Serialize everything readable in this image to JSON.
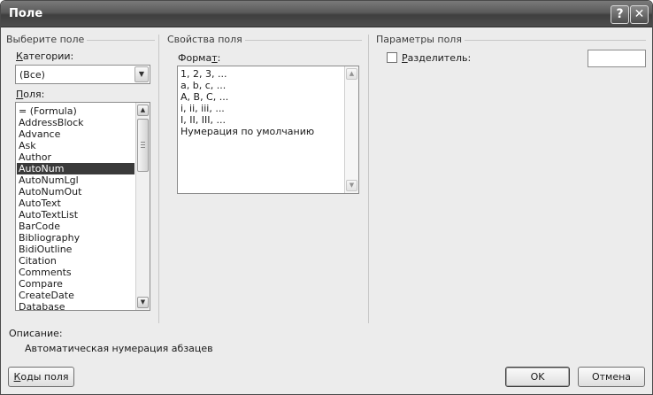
{
  "window": {
    "title": "Поле",
    "help_glyph": "?",
    "close_glyph": "✕"
  },
  "choose_field": {
    "group_label": "Выберите поле",
    "categories_label": "Категории:",
    "categories_value": "(Все)",
    "fields_label": "Поля:",
    "fields": [
      "= (Formula)",
      "AddressBlock",
      "Advance",
      "Ask",
      "Author",
      "AutoNum",
      "AutoNumLgl",
      "AutoNumOut",
      "AutoText",
      "AutoTextList",
      "BarCode",
      "Bibliography",
      "BidiOutline",
      "Citation",
      "Comments",
      "Compare",
      "CreateDate",
      "Database"
    ],
    "selected_field": "AutoNum"
  },
  "field_properties": {
    "group_label": "Свойства поля",
    "format_label": "Формат:",
    "formats": [
      "1, 2, 3, ...",
      "a, b, c, ...",
      "A, B, C, ...",
      "i, ii, iii, ...",
      "I, II, III, ...",
      "Нумерация по умолчанию"
    ]
  },
  "field_options": {
    "group_label": "Параметры поля",
    "separator_label": "Разделитель:",
    "separator_checked": false,
    "separator_value": ""
  },
  "description": {
    "label": "Описание:",
    "text": "Автоматическая нумерация абзацев"
  },
  "buttons": {
    "field_codes": "Коды поля",
    "ok": "OK",
    "cancel": "Отмена"
  },
  "icons": {
    "combo_arrow": "chevron-down-icon",
    "scroll_up": "arrow-up-icon",
    "scroll_down": "arrow-down-icon"
  }
}
